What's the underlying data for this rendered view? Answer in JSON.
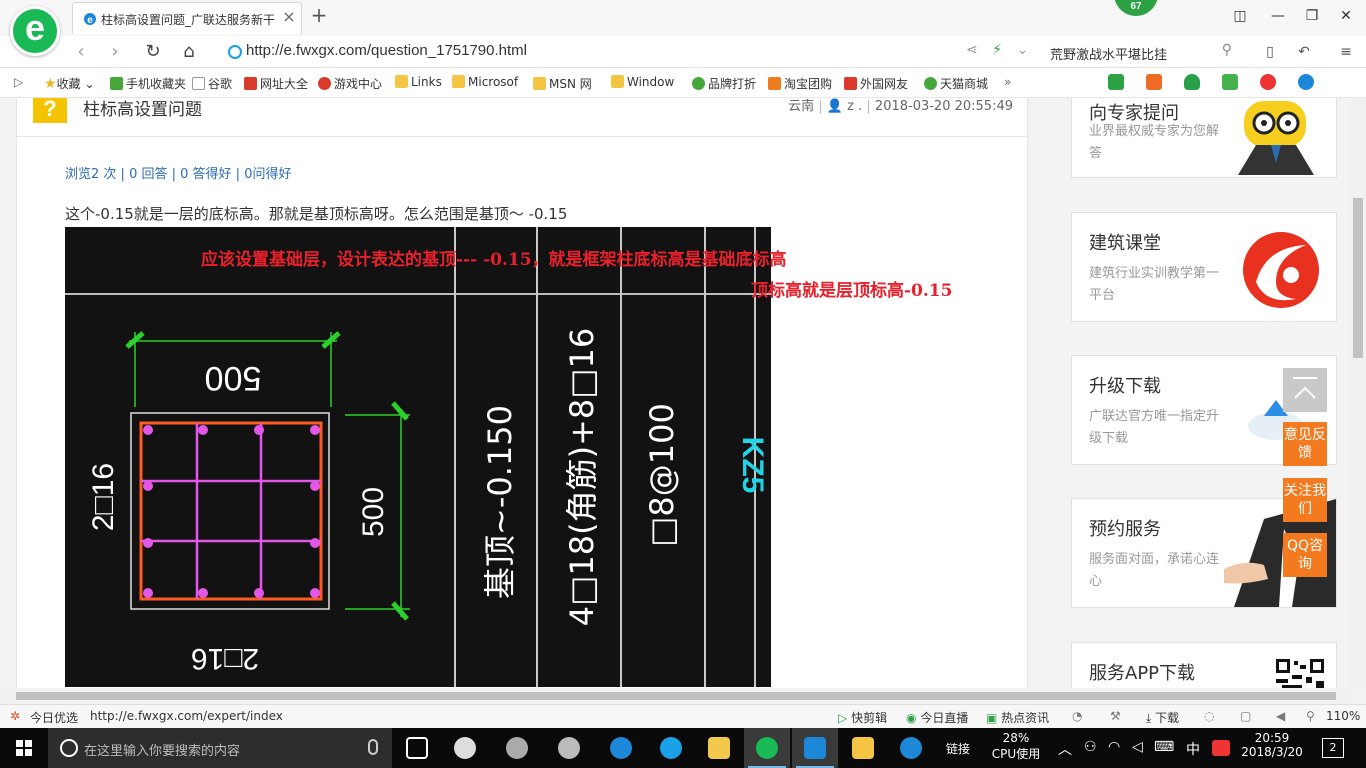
{
  "browser": {
    "tab_title": "柱标高设置问题_广联达服务新干",
    "badge": "67",
    "url": "http://e.fwxgx.com/question_1751790.html",
    "search_text": "荒野激战水平堪比挂"
  },
  "favorites": [
    {
      "label": "收藏",
      "icon": "star"
    },
    {
      "label": "手机收藏夹",
      "icon": "green"
    },
    {
      "label": "谷歌",
      "icon": "doc"
    },
    {
      "label": "网址大全",
      "icon": "red"
    },
    {
      "label": "游戏中心",
      "icon": "red"
    },
    {
      "label": "Links",
      "icon": "folder"
    },
    {
      "label": "Microsof",
      "icon": "folder"
    },
    {
      "label": "MSN 网",
      "icon": "folder"
    },
    {
      "label": "Window",
      "icon": "folder"
    },
    {
      "label": "品牌打折",
      "icon": "green"
    },
    {
      "label": "淘宝团购",
      "icon": "orange"
    },
    {
      "label": "外国网友",
      "icon": "red"
    },
    {
      "label": "天猫商城",
      "icon": "green"
    }
  ],
  "question": {
    "title": "柱标高设置问题",
    "location": "云南",
    "user": "z .",
    "datetime": "2018-03-20 20:55:49",
    "views": "浏览2 次",
    "answers": "0 回答",
    "good_answers": "0 答得好",
    "good_questions": "0问得好",
    "body": "这个-0.15就是一层的底标高。那就是基顶标高呀。怎么范围是基顶～ -0.15"
  },
  "figure": {
    "note_line1": "应该设置基础层，设计表达的基顶--- -0.15，就是框架柱底标高是基础底标高",
    "note_line2": "顶标高就是层顶标高-0.15",
    "dim_top": "500",
    "dim_right": "500",
    "dim_left": "2□16",
    "dim_bottom": "2□16",
    "col_elevation": "基顶~-0.150",
    "col_rebar": "4□18(角筋)+8□16",
    "col_stirrup": "□8@100",
    "col_name": "KZ5"
  },
  "sidebar": {
    "cards": [
      {
        "title": "向专家提问",
        "desc": "业界最权威专家为您解答"
      },
      {
        "title": "建筑课堂",
        "desc": "建筑行业实训教学第一平台"
      },
      {
        "title": "升级下载",
        "desc": "广联达官方唯一指定升级下载"
      },
      {
        "title": "预约服务",
        "desc": "服务面对面，承诺心连心"
      },
      {
        "title": "服务APP下载",
        "desc": ""
      }
    ],
    "float_buttons": [
      "意见反馈",
      "关注我们",
      "QQ咨询"
    ]
  },
  "statusbar": {
    "left": "今日优选",
    "link": "http://e.fwxgx.com/expert/index",
    "items": [
      "快剪辑",
      "今日直播",
      "热点资讯",
      "下载"
    ],
    "zoom": "110%"
  },
  "taskbar": {
    "search_placeholder": "在这里输入你要搜索的内容",
    "link_label": "链接",
    "cpu_percent": "28%",
    "cpu_label": "CPU使用",
    "ime": "中",
    "time": "20:59",
    "date": "2018/3/20",
    "notifications": "2"
  },
  "colors": {
    "accent_green": "#19b955",
    "link_blue": "#2b6cb3",
    "note_red": "#e8212c",
    "float_orange": "#f47a20"
  }
}
